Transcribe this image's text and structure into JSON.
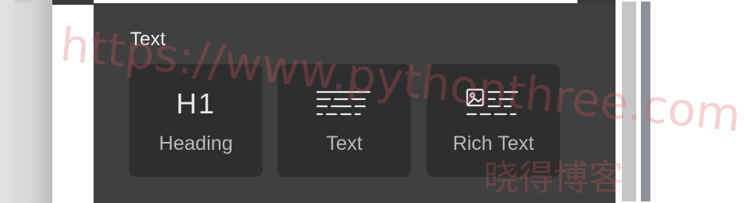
{
  "insert_panel": {
    "section_title": "Text",
    "blocks": [
      {
        "label": "Heading",
        "icon": "heading-h1-icon",
        "glyph": "H1"
      },
      {
        "label": "Text",
        "icon": "text-lines-icon"
      },
      {
        "label": "Rich Text",
        "icon": "image-text-icon"
      }
    ]
  },
  "watermark": {
    "url": "https://www.pythonthree.com",
    "cn": "晓得博客"
  },
  "colors": {
    "panel_bg": "#404040",
    "tile_bg": "#2e2e2e",
    "title_text": "#f2f2f2",
    "label_text": "#b9b9b9",
    "watermark": "#dc5a64"
  }
}
